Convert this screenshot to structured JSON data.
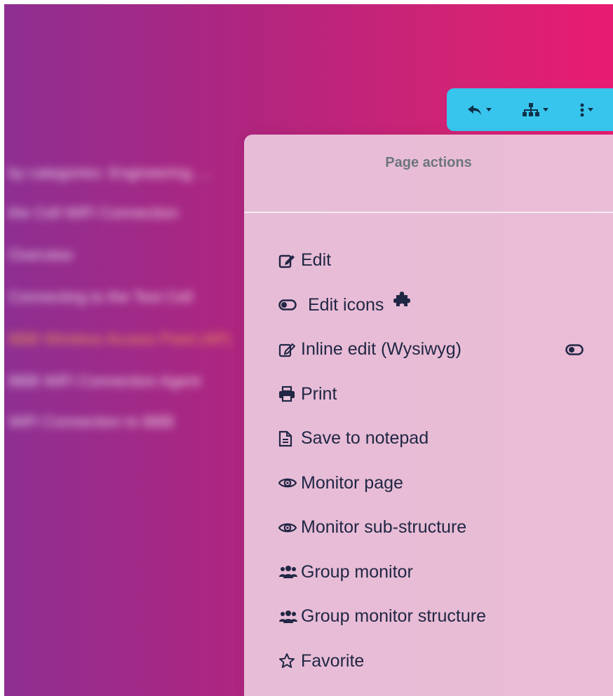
{
  "background_text": [
    "by categories: Engineering, ...",
    "the Cell WiFi Connection",
    "Overview",
    "Connecting to the Test Cell",
    "BBB Wireless Access Point (AP)",
    "BBB WiFi Connection Agent",
    "WiFi Connection to BBB"
  ],
  "toolbar": {
    "buttons": [
      {
        "name": "undo",
        "icon": "undo-icon"
      },
      {
        "name": "structure",
        "icon": "sitemap-icon"
      },
      {
        "name": "more",
        "icon": "ellipsis-vertical-icon"
      }
    ]
  },
  "menu": {
    "header": "Page actions",
    "items": [
      {
        "label": "Edit",
        "icon": "edit-icon"
      },
      {
        "label": "Edit icons",
        "icon": "toggle-icon",
        "extra": "puzzle-icon"
      },
      {
        "label": "Inline edit (Wysiwyg)",
        "icon": "edit-outline-icon",
        "extra": "toggle-icon"
      },
      {
        "label": "Print",
        "icon": "print-icon"
      },
      {
        "label": "Save to notepad",
        "icon": "file-text-icon"
      },
      {
        "label": "Monitor page",
        "icon": "eye-icon"
      },
      {
        "label": "Monitor sub-structure",
        "icon": "eye-icon"
      },
      {
        "label": "Group monitor",
        "icon": "users-icon"
      },
      {
        "label": "Group monitor structure",
        "icon": "users-icon"
      },
      {
        "label": "Favorite",
        "icon": "star-icon"
      }
    ]
  },
  "colors": {
    "gradient_start": "#8e2f92",
    "gradient_end": "#e81b72",
    "toolbar_bg": "#38c5ed",
    "menu_bg": "#ebc8de",
    "menu_text": "#202744",
    "header_text": "#6c757d"
  }
}
